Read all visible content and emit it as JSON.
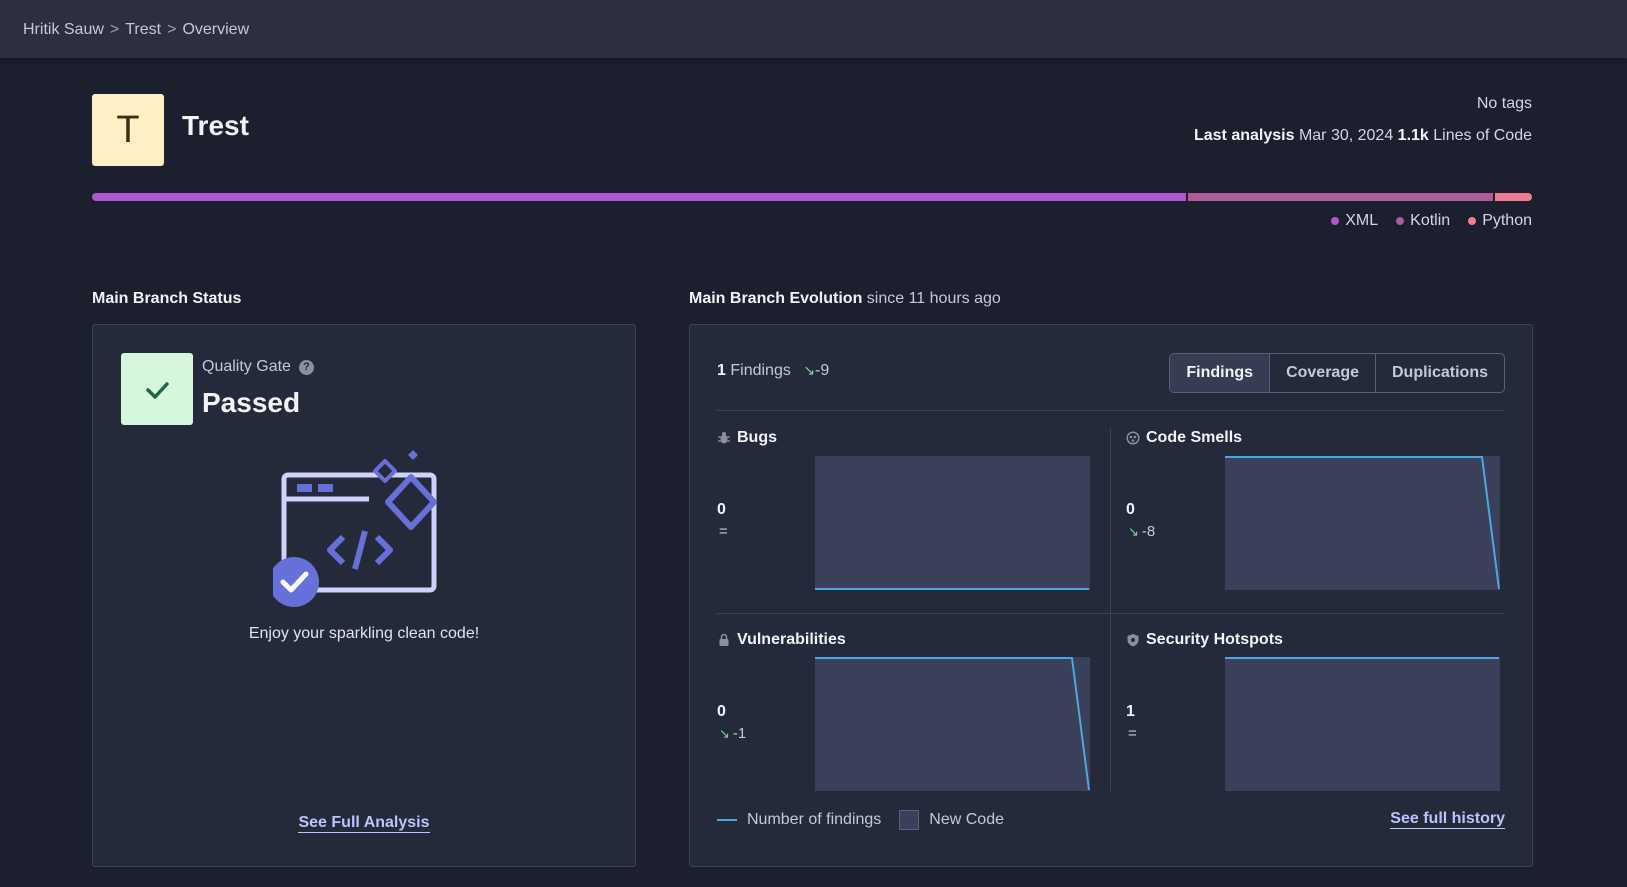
{
  "breadcrumb": [
    "Hritik Sauw",
    "Trest",
    "Overview"
  ],
  "project": {
    "avatar_letter": "T",
    "name": "Trest",
    "tags": "No tags",
    "last_analysis_label": "Last analysis",
    "last_analysis_date": "Mar 30, 2024",
    "loc_value": "1.1k",
    "loc_label": "Lines of Code"
  },
  "languages": [
    {
      "name": "XML",
      "fraction": 0.762,
      "color": "#b554d0"
    },
    {
      "name": "Kotlin",
      "fraction": 0.212,
      "color": "#b05a9a"
    },
    {
      "name": "Python",
      "fraction": 0.026,
      "color": "#f07c93"
    }
  ],
  "status": {
    "section_title": "Main Branch Status",
    "qg_label": "Quality Gate",
    "qg_help": "?",
    "qg_value": "Passed",
    "message": "Enjoy your sparkling clean code!",
    "full_analysis_link": "See Full Analysis"
  },
  "evolution": {
    "section_title": "Main Branch Evolution",
    "section_sub": "since 11 hours ago",
    "findings_count": "1",
    "findings_label": "Findings",
    "findings_delta": "-9",
    "tabs": [
      "Findings",
      "Coverage",
      "Duplications"
    ],
    "active_tab": "Findings",
    "metrics": {
      "bugs": {
        "title": "Bugs",
        "value": "0",
        "delta": "=",
        "trend": "flat",
        "spark": [
          0,
          0
        ]
      },
      "code_smells": {
        "title": "Code Smells",
        "value": "0",
        "delta": "-8",
        "trend": "down",
        "spark": [
          8,
          8,
          0
        ]
      },
      "vulnerabilities": {
        "title": "Vulnerabilities",
        "value": "0",
        "delta": "-1",
        "trend": "down",
        "spark": [
          1,
          1,
          0
        ]
      },
      "security_hotspots": {
        "title": "Security Hotspots",
        "value": "1",
        "delta": "=",
        "trend": "flat",
        "spark": [
          1,
          1
        ]
      }
    },
    "legend_findings": "Number of findings",
    "legend_new_code": "New Code",
    "full_history_link": "See full history",
    "colors": {
      "line": "#4aa8e0",
      "new_code": "#3a3f5a"
    }
  }
}
